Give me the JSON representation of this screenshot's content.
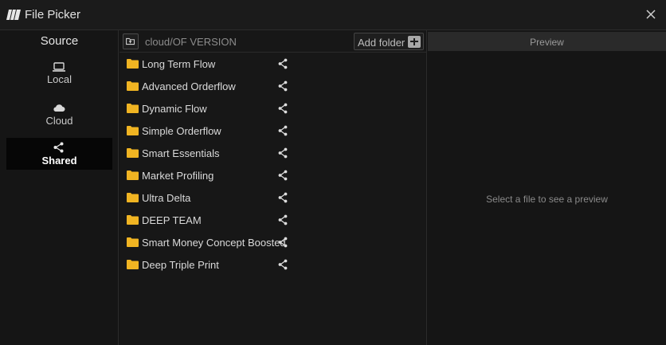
{
  "window": {
    "title": "File Picker"
  },
  "sidebar": {
    "title": "Source",
    "items": [
      {
        "label": "Local",
        "icon": "laptop-icon",
        "active": false
      },
      {
        "label": "Cloud",
        "icon": "cloud-icon",
        "active": false
      },
      {
        "label": "Shared",
        "icon": "share-icon",
        "active": true
      }
    ]
  },
  "toolbar": {
    "path": "cloud/OF VERSION",
    "add_folder_label": "Add folder"
  },
  "files": [
    {
      "name": "Long Term Flow"
    },
    {
      "name": "Advanced Orderflow"
    },
    {
      "name": "Dynamic Flow"
    },
    {
      "name": "Simple Orderflow"
    },
    {
      "name": "Smart Essentials"
    },
    {
      "name": "Market Profiling"
    },
    {
      "name": "Ultra Delta"
    },
    {
      "name": "DEEP TEAM"
    },
    {
      "name": "Smart Money Concept Boosted"
    },
    {
      "name": "Deep Triple Print"
    }
  ],
  "preview": {
    "header": "Preview",
    "empty_message": "Select a file to see a preview"
  },
  "colors": {
    "folder": "#f0b422",
    "background": "#141414",
    "active_source": "#060606"
  }
}
